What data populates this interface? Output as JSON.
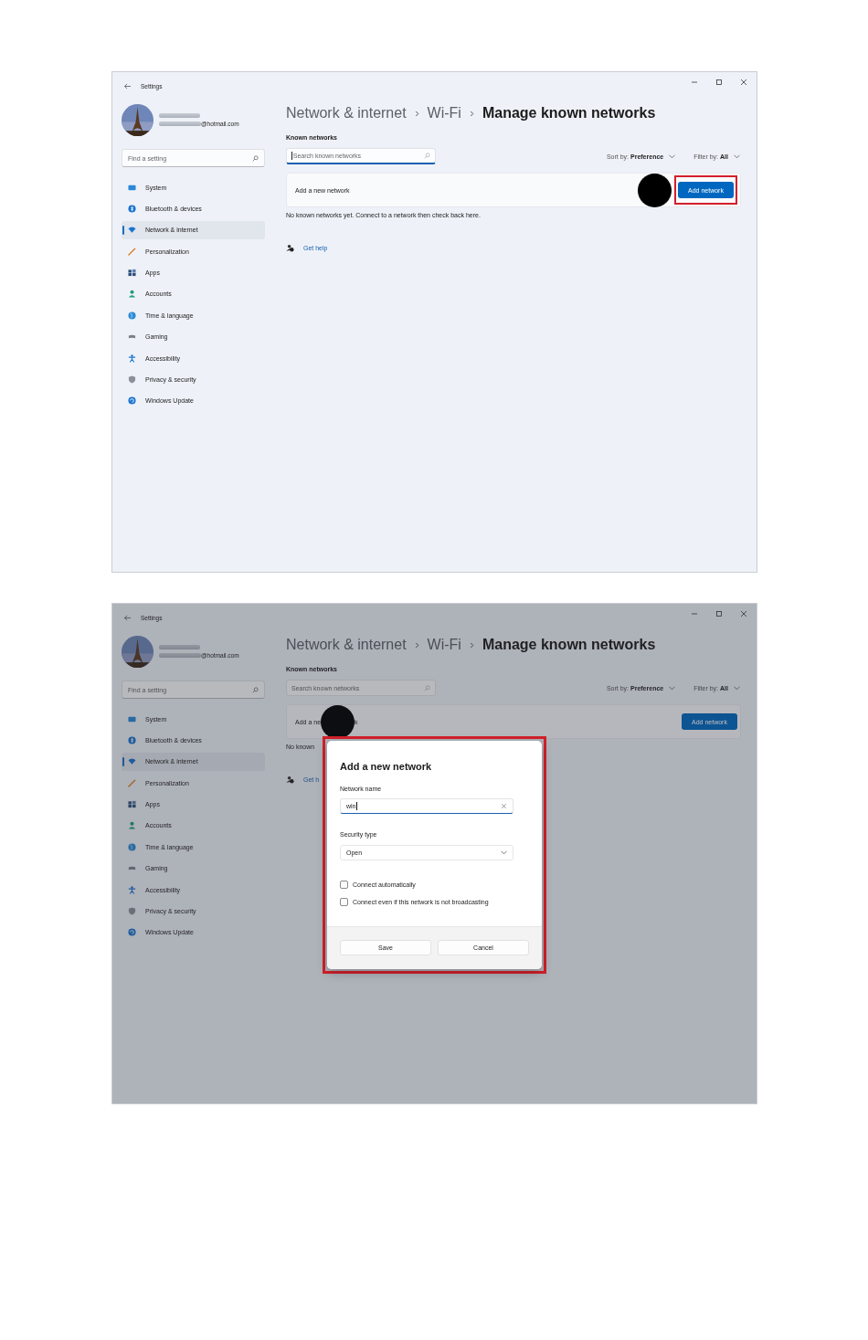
{
  "screenshots": [
    {
      "window": {
        "title": "Settings"
      },
      "account": {
        "email": "@hotmail.com"
      },
      "search": {
        "placeholder": "Find a setting"
      },
      "nav": [
        {
          "label": "System",
          "selected": false
        },
        {
          "label": "Bluetooth & devices",
          "selected": false
        },
        {
          "label": "Network & internet",
          "selected": true
        },
        {
          "label": "Personalization",
          "selected": false
        },
        {
          "label": "Apps",
          "selected": false
        },
        {
          "label": "Accounts",
          "selected": false
        },
        {
          "label": "Time & language",
          "selected": false
        },
        {
          "label": "Gaming",
          "selected": false
        },
        {
          "label": "Accessibility",
          "selected": false
        },
        {
          "label": "Privacy & security",
          "selected": false
        },
        {
          "label": "Windows Update",
          "selected": false
        }
      ],
      "breadcrumb": [
        "Network & internet",
        "Wi-Fi",
        "Manage known networks"
      ],
      "section_title": "Known networks",
      "network_search": {
        "placeholder": "Search known networks",
        "focused": true
      },
      "sort": {
        "label": "Sort by:",
        "value": "Preference"
      },
      "filter": {
        "label": "Filter by:",
        "value": "All"
      },
      "add_row": {
        "label_parts": [
          {
            "text": "Add a new network",
            "callout_after": false
          }
        ],
        "button": "Add network",
        "button_callout": true,
        "button_highlighted": true
      },
      "empty_text": "No known networks yet. Connect to a network then check back here.",
      "help_link": "Get help"
    },
    {
      "window": {
        "title": "Settings"
      },
      "account": {
        "email": "@hotmail.com"
      },
      "search": {
        "placeholder": "Find a setting"
      },
      "nav": [
        {
          "label": "System",
          "selected": false
        },
        {
          "label": "Bluetooth & devices",
          "selected": false
        },
        {
          "label": "Network & internet",
          "selected": true
        },
        {
          "label": "Personalization",
          "selected": false
        },
        {
          "label": "Apps",
          "selected": false
        },
        {
          "label": "Accounts",
          "selected": false
        },
        {
          "label": "Time & language",
          "selected": false
        },
        {
          "label": "Gaming",
          "selected": false
        },
        {
          "label": "Accessibility",
          "selected": false
        },
        {
          "label": "Privacy & security",
          "selected": false
        },
        {
          "label": "Windows Update",
          "selected": false
        }
      ],
      "breadcrumb": [
        "Network & internet",
        "Wi-Fi",
        "Manage known networks"
      ],
      "section_title": "Known networks",
      "network_search": {
        "placeholder": "Search known networks",
        "focused": false
      },
      "sort": {
        "label": "Sort by:",
        "value": "Preference"
      },
      "filter": {
        "label": "Filter by:",
        "value": "All"
      },
      "add_row": {
        "label_parts": [
          {
            "text": "Add a ne",
            "callout_after": true
          },
          {
            "text": "k",
            "callout_after": false
          }
        ],
        "button": "Add network",
        "button_callout": false,
        "button_highlighted": false
      },
      "empty_text": "No known",
      "help_link": "Get h",
      "dialog": {
        "highlighted": true,
        "title": "Add a new network",
        "name_label": "Network name",
        "name_value": "win",
        "security_label": "Security type",
        "security_value": "Open",
        "options": [
          {
            "label": "Connect automatically",
            "checked": false
          },
          {
            "label": "Connect even if this network is not broadcasting",
            "checked": false
          }
        ],
        "buttons": [
          "Save",
          "Cancel"
        ]
      }
    }
  ]
}
